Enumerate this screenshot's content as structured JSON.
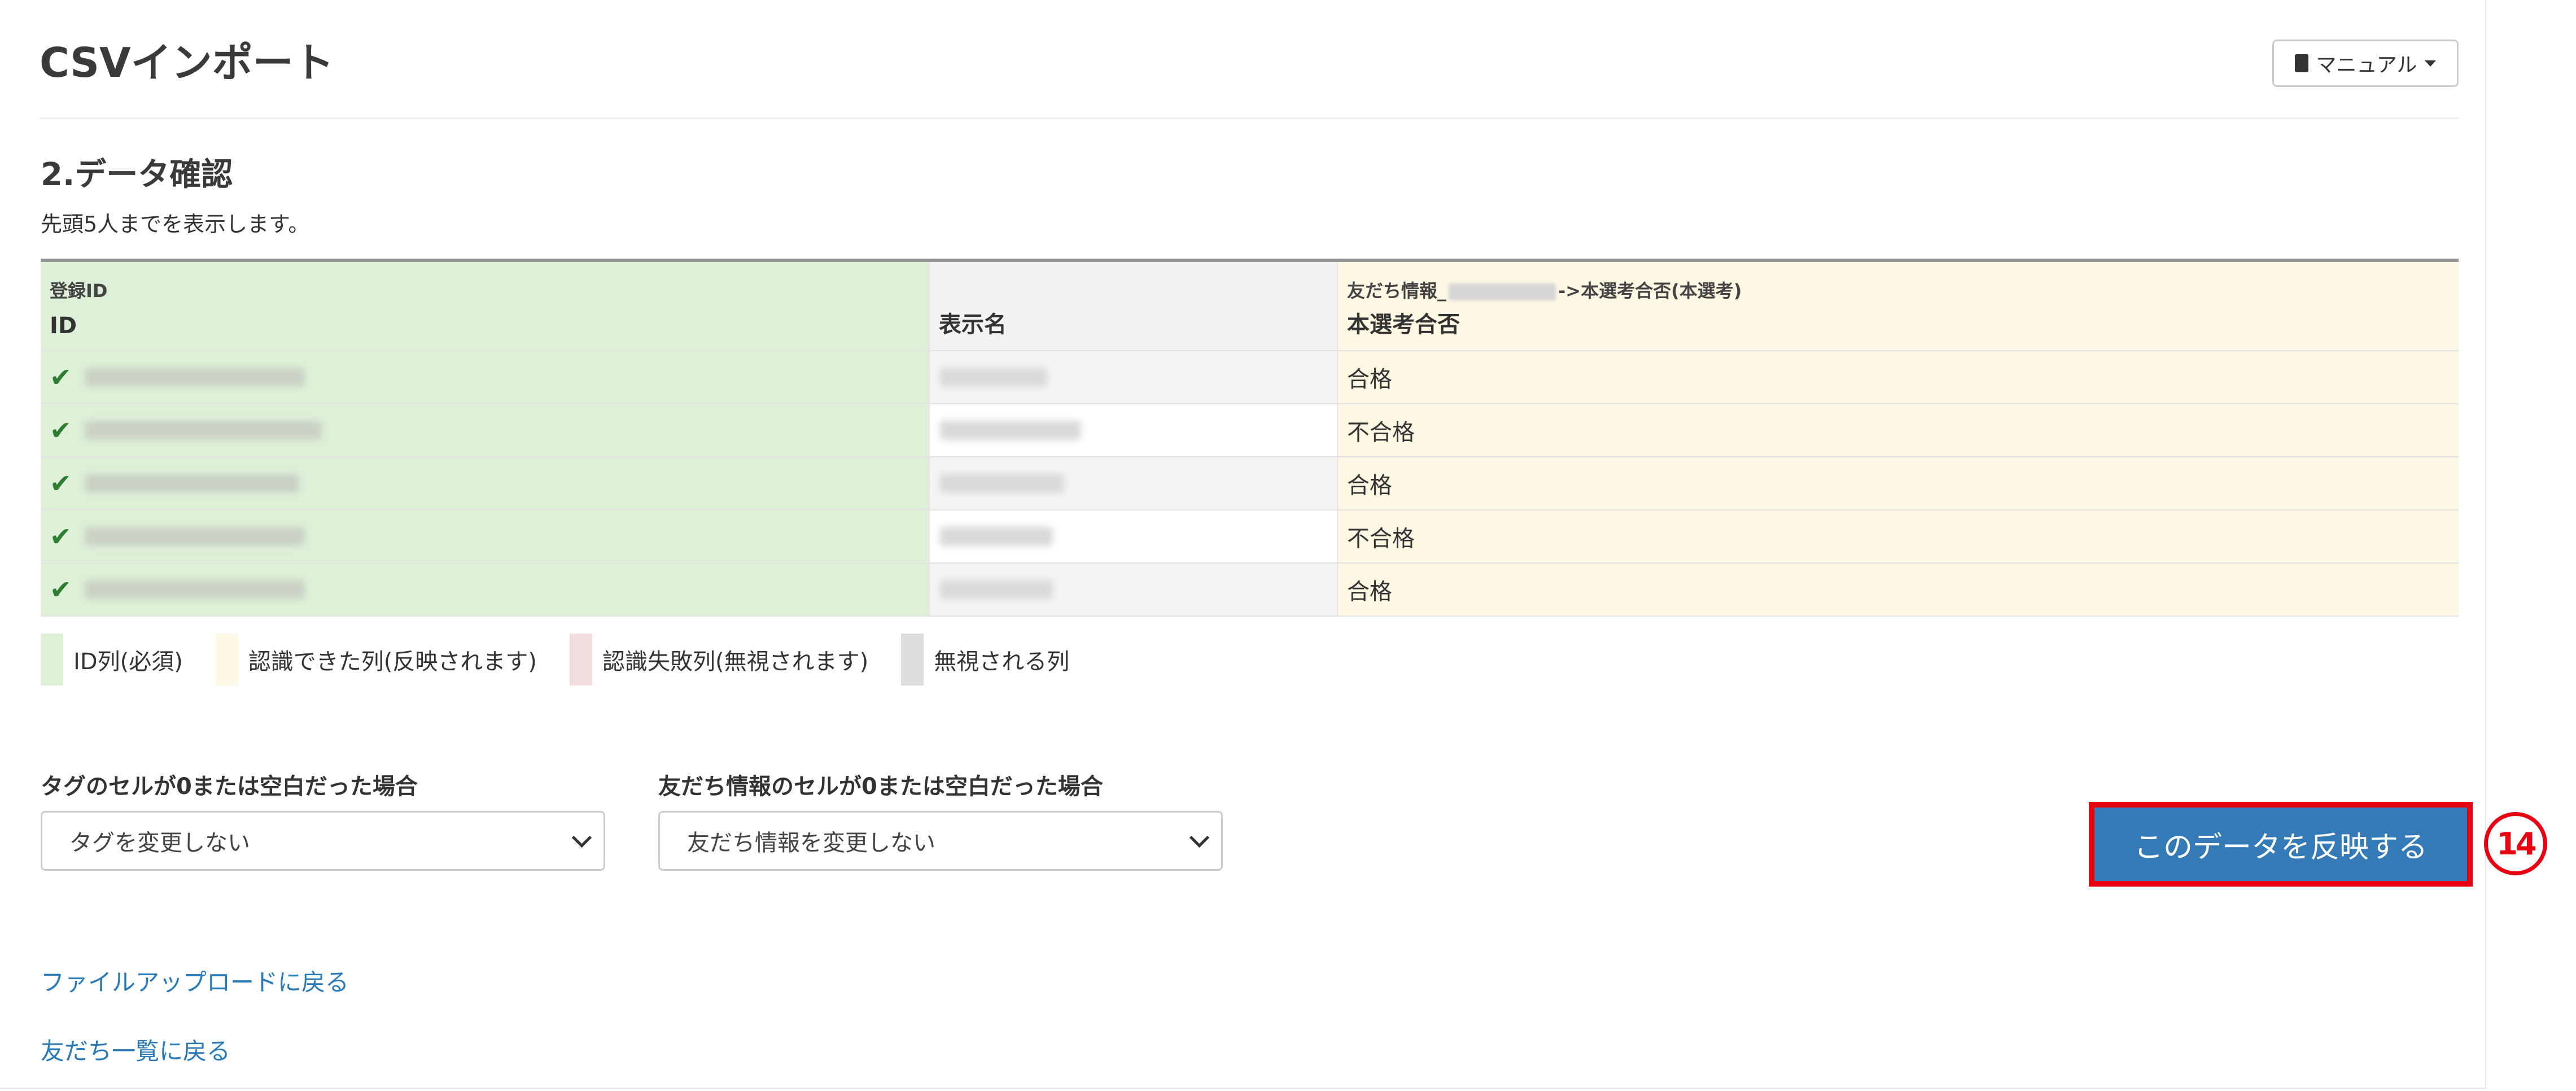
{
  "header": {
    "title": "CSVインポート",
    "manual_label": "マニュアル"
  },
  "section": {
    "heading": "2.データ確認",
    "note": "先頭5人までを表示します。"
  },
  "table": {
    "columns": [
      {
        "sub": "登録ID",
        "main": "ID"
      },
      {
        "sub": "",
        "main": "表示名"
      },
      {
        "sub_prefix": "友だち情報_",
        "sub_suffix": "->本選考合否(本選考)",
        "main": "本選考合否"
      }
    ],
    "rows": [
      {
        "result": "合格"
      },
      {
        "result": "不合格"
      },
      {
        "result": "合格"
      },
      {
        "result": "不合格"
      },
      {
        "result": "合格"
      }
    ]
  },
  "legend": [
    {
      "label": "ID列(必須)",
      "color": "#dff0d8"
    },
    {
      "label": "認識できた列(反映されます)",
      "color": "#fcf8e3"
    },
    {
      "label": "認識失敗列(無視されます)",
      "color": "#f2dede"
    },
    {
      "label": "無視される列",
      "color": "#dddddd"
    }
  ],
  "options": {
    "tag_label": "タグのセルが0または空白だった場合",
    "tag_selected": "タグを変更しない",
    "friend_label": "友だち情報のセルが0または空白だった場合",
    "friend_selected": "友だち情報を変更しない"
  },
  "actions": {
    "apply_label": "このデータを反映する",
    "step_number": "14"
  },
  "links": {
    "back_upload": "ファイルアップロードに戻る",
    "back_list": "友だち一覧に戻る"
  },
  "colors": {
    "primary": "#337ab7",
    "highlight": "#e60012",
    "link": "#2a7ab8",
    "check": "#2e7d32"
  }
}
